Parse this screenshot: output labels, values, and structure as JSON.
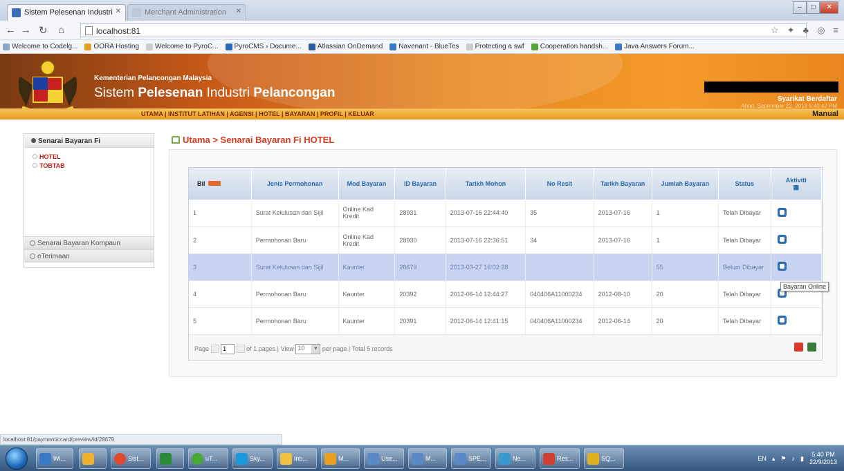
{
  "browser": {
    "tabs": [
      {
        "label": "Sistem Pelesenan Industri",
        "active": true
      },
      {
        "label": "Merchant Administration",
        "active": false
      }
    ],
    "address": "localhost:81",
    "bookmarks": [
      "Welcome to Codelg...",
      "OORA Hosting",
      "Welcome to PyroC...",
      "PyroCMS › Docume...",
      "Atlassian OnDemand",
      "Navenant - BlueTes",
      "Protecting a swf",
      "Cooperation handsh...",
      "Java Answers Forum..."
    ],
    "status_url": "localhost:81/payment/ccard/preview/id/28679"
  },
  "header": {
    "ministry": "Kementerian Pelancongan Malaysia",
    "title_pre": "Sistem ",
    "title_bold1": "Pelesenan",
    "title_mid": " Industri ",
    "title_bold2": "Pelancongan",
    "company": "Syarikat Berdaftar",
    "datetime": "Ahad, September 22, 2013 5:40:42 PM",
    "menu": [
      "UTAMA",
      "INSTITUT LATIHAN",
      "AGENSI",
      "HOTEL",
      "BAYARAN",
      "PROFIL",
      "KELUAR"
    ],
    "manual": "Manual"
  },
  "sidebar": {
    "heading": "Senarai Bayaran Fi",
    "items": [
      "HOTEL",
      "TOBTAB"
    ],
    "accordion": [
      "Senarai Bayaran Kompaun",
      "eTerimaan"
    ]
  },
  "breadcrumb": "Utama > Senarai Bayaran Fi HOTEL",
  "table": {
    "headers": [
      "Bil",
      "Jenis Permohonan",
      "Mod Bayaran",
      "ID Bayaran",
      "Tarikh Mohon",
      "No Resit",
      "Tarikh Bayaran",
      "Jumlah Bayaran",
      "Status",
      "Aktiviti"
    ],
    "rows": [
      {
        "bil": "1",
        "jenis": "Surat Kelulusan dan Sijil",
        "mod": "Online Kad Kredit",
        "id": "28931",
        "tarikh_mohon": "2013-07-16 22:44:40",
        "resit": "35",
        "tarikh_bayaran": "2013-07-16",
        "jumlah": "1",
        "status": "Telah Dibayar"
      },
      {
        "bil": "2",
        "jenis": "Permohonan Baru",
        "mod": "Online Kad Kredit",
        "id": "28930",
        "tarikh_mohon": "2013-07-16 22:36:51",
        "resit": "34",
        "tarikh_bayaran": "2013-07-16",
        "jumlah": "1",
        "status": "Telah Dibayar"
      },
      {
        "bil": "3",
        "jenis": "Surat Kelulusan dan Sijil",
        "mod": "Kaunter",
        "id": "28679",
        "tarikh_mohon": "2013-03-27 16:02:28",
        "resit": "",
        "tarikh_bayaran": "",
        "jumlah": "55",
        "status": "Belum Dibayar"
      },
      {
        "bil": "4",
        "jenis": "Permohonan Baru",
        "mod": "Kaunter",
        "id": "20392",
        "tarikh_mohon": "2012-06-14 12:44:27",
        "resit": "040406A11000234",
        "tarikh_bayaran": "2012-08-10",
        "jumlah": "20",
        "status": "Telah Dibayar"
      },
      {
        "bil": "5",
        "jenis": "Permohonan Baru",
        "mod": "Kaunter",
        "id": "20391",
        "tarikh_mohon": "2012-06-14 12:41:15",
        "resit": "040406A11000234",
        "tarikh_bayaran": "2012-06-14",
        "jumlah": "20",
        "status": "Telah Dibayar"
      }
    ],
    "pager": {
      "page_label": "Page",
      "page_value": "1",
      "of_pages": "of 1 pages",
      "view_label": "View",
      "view_value": "10",
      "summary": "per page | Total 5 records"
    }
  },
  "tooltip": "Bayaran Online",
  "taskbar": {
    "items": [
      "Wi...",
      "",
      "Sist...",
      "",
      "uT...",
      "Sky...",
      "Inb...",
      "M...",
      "Use...",
      "M...",
      "SPE...",
      "Ne...",
      "Res...",
      "SQ..."
    ],
    "lang": "EN",
    "time": "5:40 PM",
    "date": "22/9/2013"
  },
  "colors": {
    "accent_orange": "#e8871f",
    "link_red": "#d4391c",
    "header_blue": "#2a67a8",
    "row_highlight": "#c9d4f2"
  }
}
